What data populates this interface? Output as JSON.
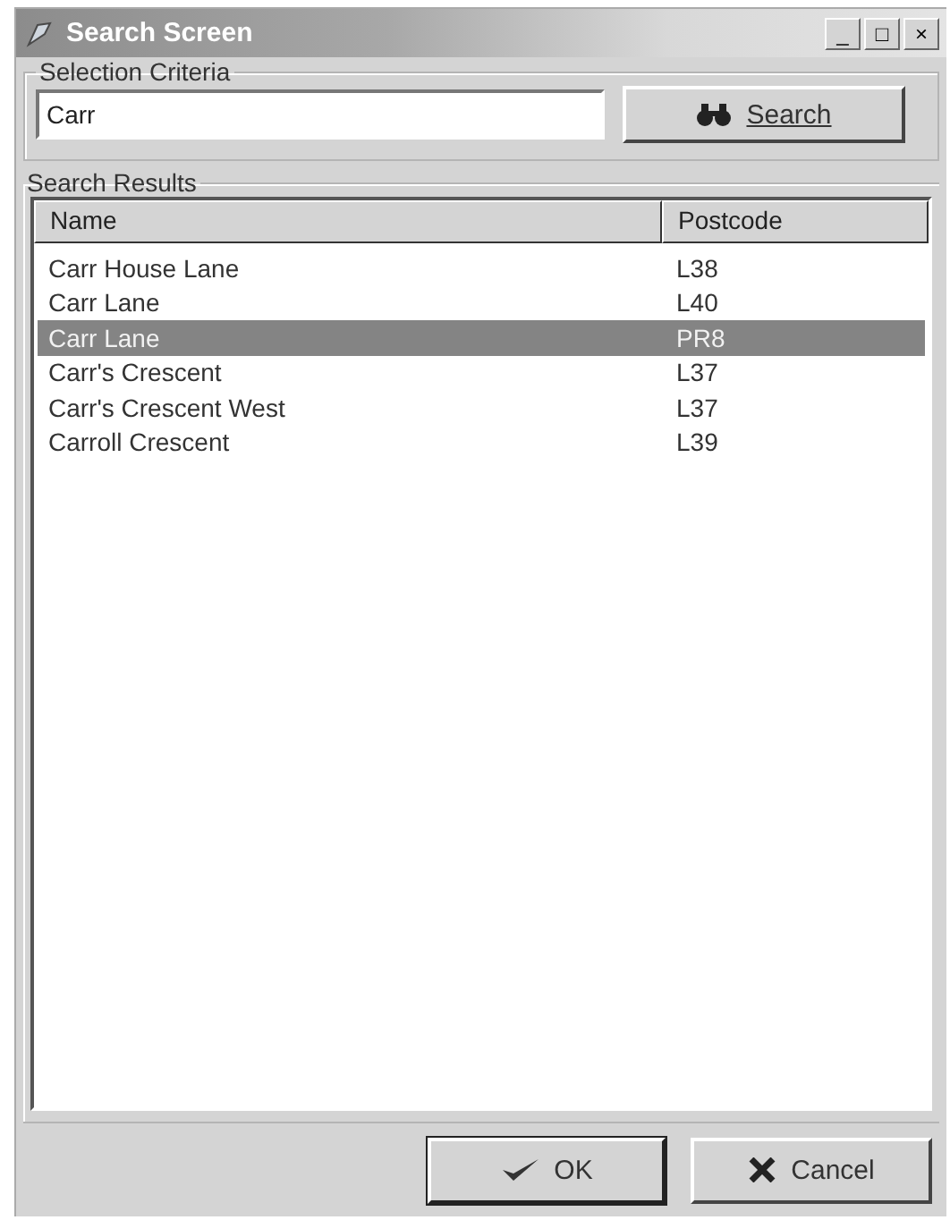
{
  "window": {
    "title": "Search Screen",
    "controls": [
      "_",
      "□",
      "×"
    ]
  },
  "selection_criteria": {
    "label": "Selection Criteria",
    "search_value": "Carr",
    "search_button": "Search"
  },
  "search_results": {
    "label": "Search Results",
    "columns": [
      "Name",
      "Postcode"
    ],
    "rows": [
      {
        "name": "Carr House Lane",
        "postcode": "L38",
        "selected": false
      },
      {
        "name": "Carr Lane",
        "postcode": "L40",
        "selected": false
      },
      {
        "name": "Carr Lane",
        "postcode": "PR8",
        "selected": true
      },
      {
        "name": "Carr's Crescent",
        "postcode": "L37",
        "selected": false
      },
      {
        "name": "Carr's Crescent West",
        "postcode": "L37",
        "selected": false
      },
      {
        "name": "Carroll Crescent",
        "postcode": "L39",
        "selected": false
      }
    ]
  },
  "buttons": [
    {
      "kind": "ok",
      "label": "OK"
    },
    {
      "kind": "cancel",
      "label": "Cancel"
    }
  ]
}
